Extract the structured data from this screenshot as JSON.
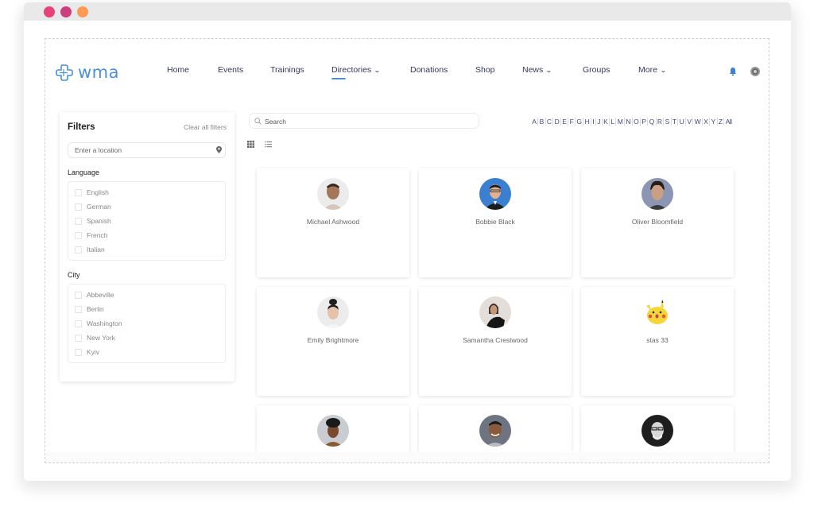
{
  "window": {
    "controls": [
      "close",
      "minimize",
      "maximize"
    ]
  },
  "header": {
    "logo_text": "wma",
    "logo_icon": "cross-logo-icon",
    "nav": [
      {
        "label": "Home",
        "dropdown": false,
        "active": false
      },
      {
        "label": "Events",
        "dropdown": false,
        "active": false
      },
      {
        "label": "Trainings",
        "dropdown": false,
        "active": false
      },
      {
        "label": "Directories",
        "dropdown": true,
        "active": true
      },
      {
        "label": "Donations",
        "dropdown": false,
        "active": false
      },
      {
        "label": "Shop",
        "dropdown": false,
        "active": false
      },
      {
        "label": "News",
        "dropdown": true,
        "active": false
      },
      {
        "label": "Groups",
        "dropdown": false,
        "active": false
      },
      {
        "label": "More",
        "dropdown": true,
        "active": false
      }
    ],
    "chevron": "⌄",
    "icons": [
      "bell-icon",
      "profile-icon"
    ]
  },
  "filters": {
    "title": "Filters",
    "clear_label": "Clear all filters",
    "location_placeholder": "Enter a location",
    "language_label": "Language",
    "languages": [
      "English",
      "German",
      "Spanish",
      "French",
      "Italian"
    ],
    "city_label": "City",
    "cities": [
      "Abbeville",
      "Berlin",
      "Washington",
      "New York",
      "Kyiv"
    ]
  },
  "search": {
    "placeholder": "Search"
  },
  "alphabet": [
    "A",
    "B",
    "C",
    "D",
    "E",
    "F",
    "G",
    "H",
    "I",
    "J",
    "K",
    "L",
    "M",
    "N",
    "O",
    "P",
    "Q",
    "R",
    "S",
    "T",
    "U",
    "V",
    "W",
    "X",
    "Y",
    "Z",
    "All"
  ],
  "view_modes": [
    "grid",
    "list"
  ],
  "members": [
    {
      "name": "Michael Ashwood"
    },
    {
      "name": "Bobbie Black"
    },
    {
      "name": "Oliver Bloomfield"
    },
    {
      "name": "Emily Brightmore"
    },
    {
      "name": "Samantha Crestwood"
    },
    {
      "name": "stas 33"
    },
    {
      "name": ""
    },
    {
      "name": ""
    },
    {
      "name": ""
    }
  ],
  "colors": {
    "accent": "#4a90d9",
    "nav_text": "#2f3a5a",
    "close": "#e8427a",
    "minimize": "#cc3f7f",
    "maximize": "#fd9a56"
  }
}
